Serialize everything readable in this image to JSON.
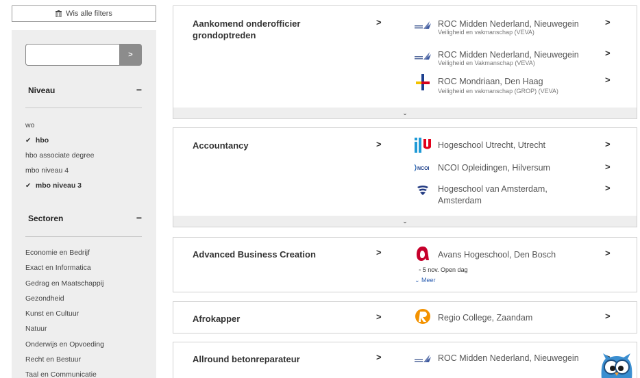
{
  "sidebar": {
    "clear_filters_label": "Wis alle filters",
    "search": {
      "value": "",
      "placeholder": "",
      "go_label": ">"
    },
    "niveau": {
      "title": "Niveau",
      "toggle": "−",
      "items": [
        {
          "label": "wo",
          "checked": false
        },
        {
          "label": "hbo",
          "checked": true
        },
        {
          "label": "hbo associate degree",
          "checked": false
        },
        {
          "label": "mbo niveau 4",
          "checked": false
        },
        {
          "label": "mbo niveau 3",
          "checked": true
        }
      ]
    },
    "sectoren": {
      "title": "Sectoren",
      "toggle": "−",
      "items": [
        "Economie en Bedrijf",
        "Exact en Informatica",
        "Gedrag en Maatschappij",
        "Gezondheid",
        "Kunst en Cultuur",
        "Natuur",
        "Onderwijs en Opvoeding",
        "Recht en Bestuur",
        "Taal en Communicatie"
      ]
    }
  },
  "check_glyph": "✔",
  "arrow_glyph": ">",
  "expand_glyph": "⌄",
  "results": [
    {
      "title": "Aankomend onderofficier grondoptreden",
      "institutions": [
        {
          "name": "ROC Midden Nederland, Nieuwegein",
          "sub": "Veiligheid en vakmanschap (VEVA)",
          "logo": "roc-midden-logo"
        },
        {
          "name": "ROC Midden Nederland, Nieuwegein",
          "sub": "Veiligheid en Vakmanschap (VEVA)",
          "logo": "roc-midden-logo"
        },
        {
          "name": "ROC Mondriaan, Den Haag",
          "sub": "Veiligheid en vakmanschap (GROP) (VEVA)",
          "logo": "roc-mondriaan-logo"
        }
      ]
    },
    {
      "title": "Accountancy",
      "institutions": [
        {
          "name": "Hogeschool Utrecht, Utrecht",
          "logo": "hu-logo"
        },
        {
          "name": "NCOI Opleidingen, Hilversum",
          "logo": "ncoi-logo"
        },
        {
          "name": "Hogeschool van Amsterdam,",
          "name2": "Amsterdam",
          "logo": "hva-logo"
        }
      ]
    },
    {
      "title": "Advanced Business Creation",
      "institutions": [
        {
          "name": "Avans Hogeschool, Den Bosch",
          "logo": "avans-logo"
        }
      ],
      "event": "◦ 5 nov. Open dag",
      "meer": "⌄ Meer"
    },
    {
      "title": "Afrokapper",
      "institutions": [
        {
          "name": "Regio College, Zaandam",
          "logo": "regio-college-logo"
        }
      ]
    },
    {
      "title": "Allround betonreparateur",
      "institutions": [
        {
          "name": "ROC Midden Nederland, Nieuwegein",
          "logo": "roc-midden-logo"
        }
      ]
    }
  ],
  "colors": {
    "hu_blue": "#1f9ad6",
    "hu_red": "#e2001a",
    "avans_red": "#c6002b",
    "regio_orange": "#f39200",
    "hva_blue": "#233b82",
    "mondriaan_yellow": "#f2c200",
    "mondriaan_red": "#d6001c",
    "mondriaan_blue": "#1d3f8f"
  }
}
